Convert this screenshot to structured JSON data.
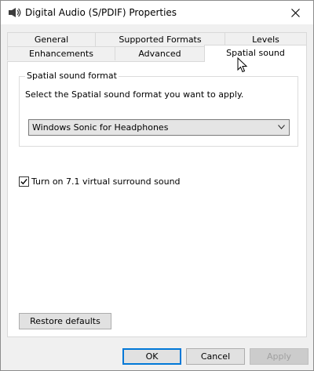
{
  "window": {
    "title": "Digital Audio (S/PDIF) Properties",
    "icon": "speaker-icon"
  },
  "tabs": {
    "general": "General",
    "supported_formats": "Supported Formats",
    "levels": "Levels",
    "enhancements": "Enhancements",
    "advanced": "Advanced",
    "spatial_sound": "Spatial sound",
    "active": "Spatial sound"
  },
  "spatial": {
    "group_title": "Spatial sound format",
    "description": "Select the Spatial sound format you want to apply.",
    "selected_format": "Windows Sonic for Headphones",
    "virtual_surround_label": "Turn on 7.1 virtual surround sound",
    "virtual_surround_checked": true,
    "restore_defaults": "Restore defaults"
  },
  "footer": {
    "ok": "OK",
    "cancel": "Cancel",
    "apply": "Apply",
    "apply_enabled": false
  },
  "colors": {
    "accent": "#0078d7",
    "dialog_bg": "#f0f0f0",
    "panel_bg": "#ffffff"
  }
}
